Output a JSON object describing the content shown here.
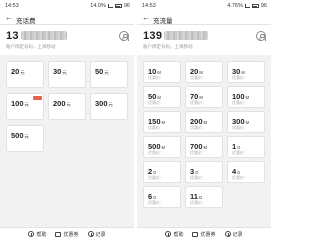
{
  "left": {
    "status": {
      "time": "14:53",
      "battery": "14.0%",
      "level": "96"
    },
    "title": "充话费",
    "phone": {
      "number": "13",
      "subtitle": "账户绑定号码，上海移动"
    },
    "grid": [
      {
        "amount": "20",
        "unit": "元",
        "price": "",
        "badge": false
      },
      {
        "amount": "30",
        "unit": "元",
        "price": "",
        "badge": false
      },
      {
        "amount": "50",
        "unit": "元",
        "price": "",
        "badge": false
      },
      {
        "amount": "100",
        "unit": "元",
        "price": "",
        "badge": true
      },
      {
        "amount": "200",
        "unit": "元",
        "price": "",
        "badge": false
      },
      {
        "amount": "300",
        "unit": "元",
        "price": "",
        "badge": false
      },
      {
        "amount": "500",
        "unit": "元",
        "price": "",
        "badge": false
      }
    ],
    "bottom": [
      "帮助",
      "优惠券",
      "记录"
    ]
  },
  "right": {
    "status": {
      "time": "14:53",
      "battery": "4.76%",
      "level": "96"
    },
    "title": "充流量",
    "phone": {
      "number": "139",
      "subtitle": "账户绑定号码，上海移动"
    },
    "grid": [
      {
        "amount": "10",
        "unit": "M",
        "price": "优惠价：",
        "badge": false
      },
      {
        "amount": "20",
        "unit": "M",
        "price": "优惠价：",
        "badge": false
      },
      {
        "amount": "30",
        "unit": "M",
        "price": "优惠价：",
        "badge": false
      },
      {
        "amount": "50",
        "unit": "M",
        "price": "优惠价：",
        "badge": false
      },
      {
        "amount": "70",
        "unit": "M",
        "price": "优惠价：",
        "badge": false
      },
      {
        "amount": "100",
        "unit": "M",
        "price": "优惠价：",
        "badge": false
      },
      {
        "amount": "150",
        "unit": "M",
        "price": "优惠价：",
        "badge": false
      },
      {
        "amount": "200",
        "unit": "M",
        "price": "优惠价：",
        "badge": false
      },
      {
        "amount": "300",
        "unit": "M",
        "price": "优惠价：",
        "badge": false
      },
      {
        "amount": "500",
        "unit": "M",
        "price": "优惠价：",
        "badge": false
      },
      {
        "amount": "700",
        "unit": "M",
        "price": "优惠价：",
        "badge": false
      },
      {
        "amount": "1",
        "unit": "G",
        "price": "优惠价：",
        "badge": false
      },
      {
        "amount": "2",
        "unit": "G",
        "price": "优惠价：",
        "badge": false
      },
      {
        "amount": "3",
        "unit": "G",
        "price": "优惠价：",
        "badge": false
      },
      {
        "amount": "4",
        "unit": "G",
        "price": "优惠价：",
        "badge": false
      },
      {
        "amount": "6",
        "unit": "G",
        "price": "优惠价：",
        "badge": false
      },
      {
        "amount": "11",
        "unit": "G",
        "price": "优惠价：",
        "badge": false
      }
    ],
    "bottom": [
      "帮助",
      "优惠券",
      "记录"
    ]
  },
  "icons": {
    "back": "back-arrow-icon",
    "contact": "contact-book-icon",
    "help": "help-icon",
    "coupon": "coupon-icon",
    "record": "record-icon",
    "signal": "signal-icon",
    "battery": "battery-icon"
  },
  "colors": {
    "background": "#f2f2f2",
    "card": "#ffffff",
    "badge": "#e8604c",
    "text": "#222222",
    "muted": "#aaaaaa"
  }
}
